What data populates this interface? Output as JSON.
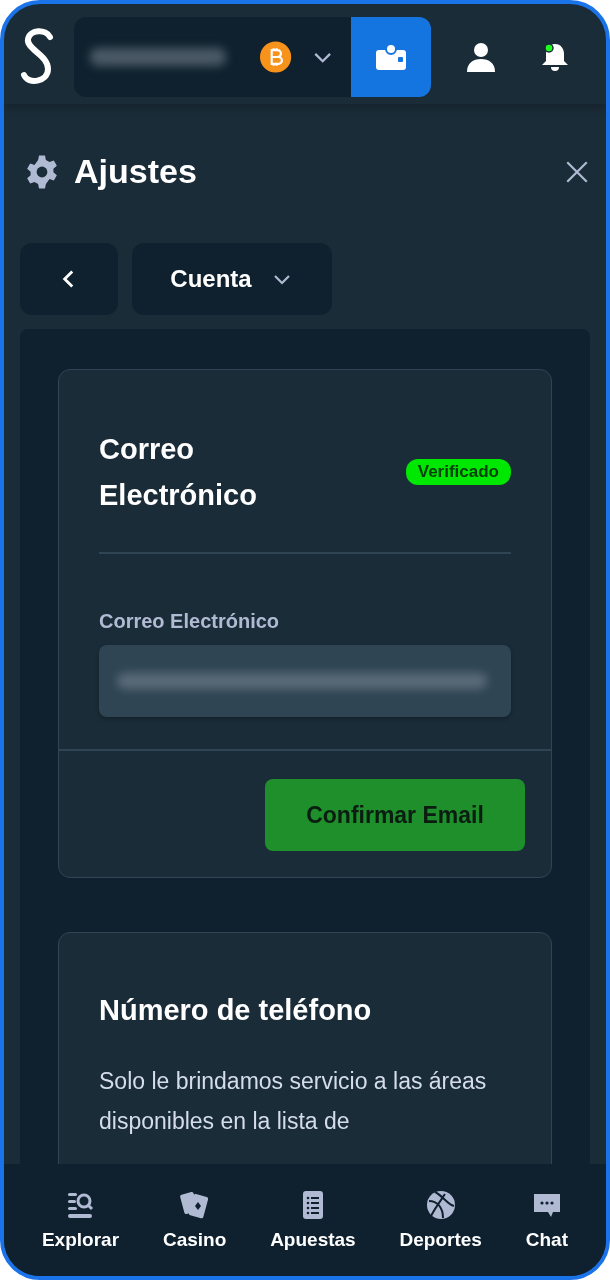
{
  "page": {
    "title": "Ajustes"
  },
  "section_select": {
    "value": "Cuenta"
  },
  "email_card": {
    "title": "Correo Electrónico",
    "badge": "Verificado",
    "field_label": "Correo Electrónico",
    "button": "Confirmar Email"
  },
  "phone_card": {
    "title": "Número de teléfono",
    "text": "Solo le brindamos servicio a las áreas disponibles en la lista de"
  },
  "bottom_nav": [
    {
      "label": "Explorar"
    },
    {
      "label": "Casino"
    },
    {
      "label": "Apuestas"
    },
    {
      "label": "Deportes"
    },
    {
      "label": "Chat"
    }
  ]
}
